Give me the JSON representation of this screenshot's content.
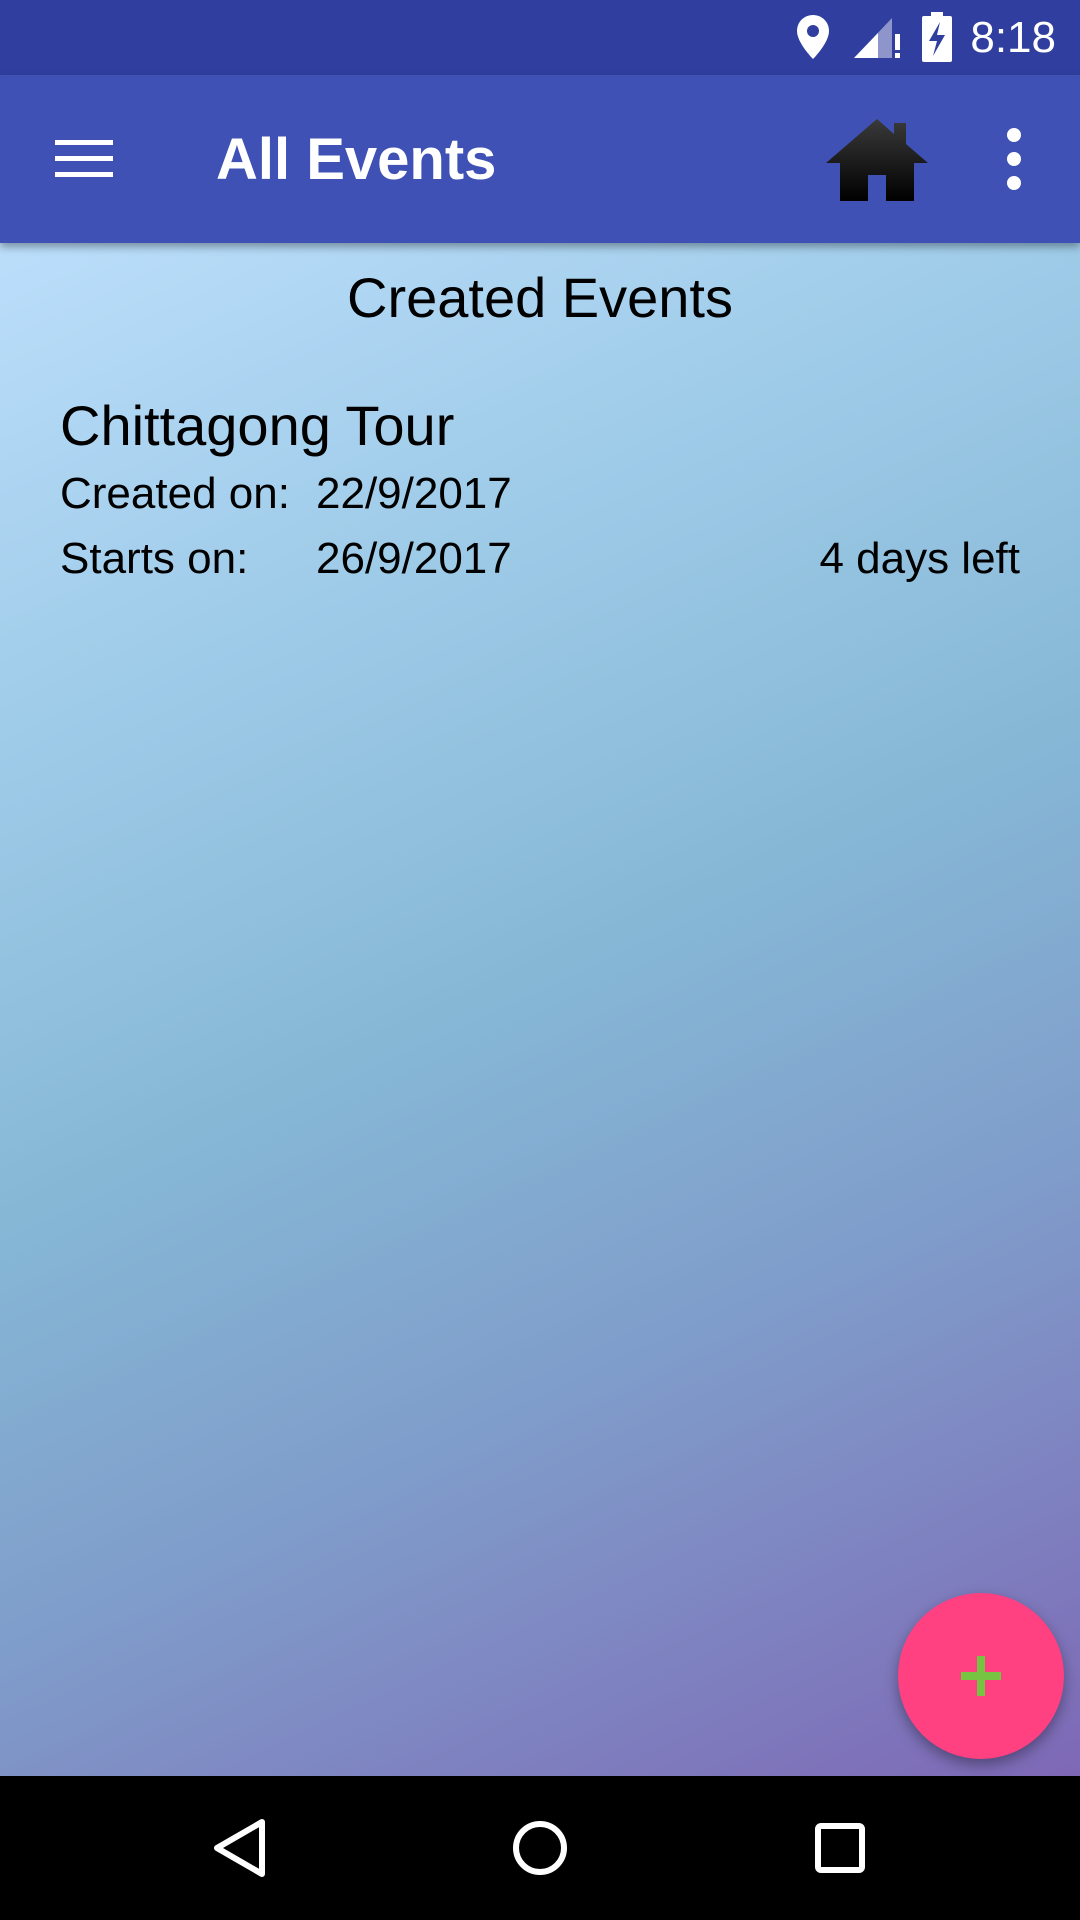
{
  "status_bar": {
    "time": "8:18",
    "icons": [
      "location-icon",
      "signal-icon",
      "battery-charging-icon"
    ],
    "background": "#303f9f"
  },
  "app_bar": {
    "title": "All Events",
    "menu_icon": "hamburger-menu-icon",
    "home_icon": "home-icon",
    "overflow_icon": "more-vert-icon",
    "background": "#3f51b5"
  },
  "content": {
    "section_title": "Created Events",
    "events": [
      {
        "name": "Chittagong Tour",
        "created_label": "Created on:",
        "created_date": "22/9/2017",
        "starts_label": "Starts on:",
        "starts_date": "26/9/2017",
        "days_left": "4 days left"
      }
    ]
  },
  "fab": {
    "icon": "plus-icon",
    "background": "#ff4081",
    "icon_color": "#76c442"
  },
  "nav_bar": {
    "icons": [
      "back-icon",
      "home-circle-icon",
      "recents-icon"
    ]
  }
}
